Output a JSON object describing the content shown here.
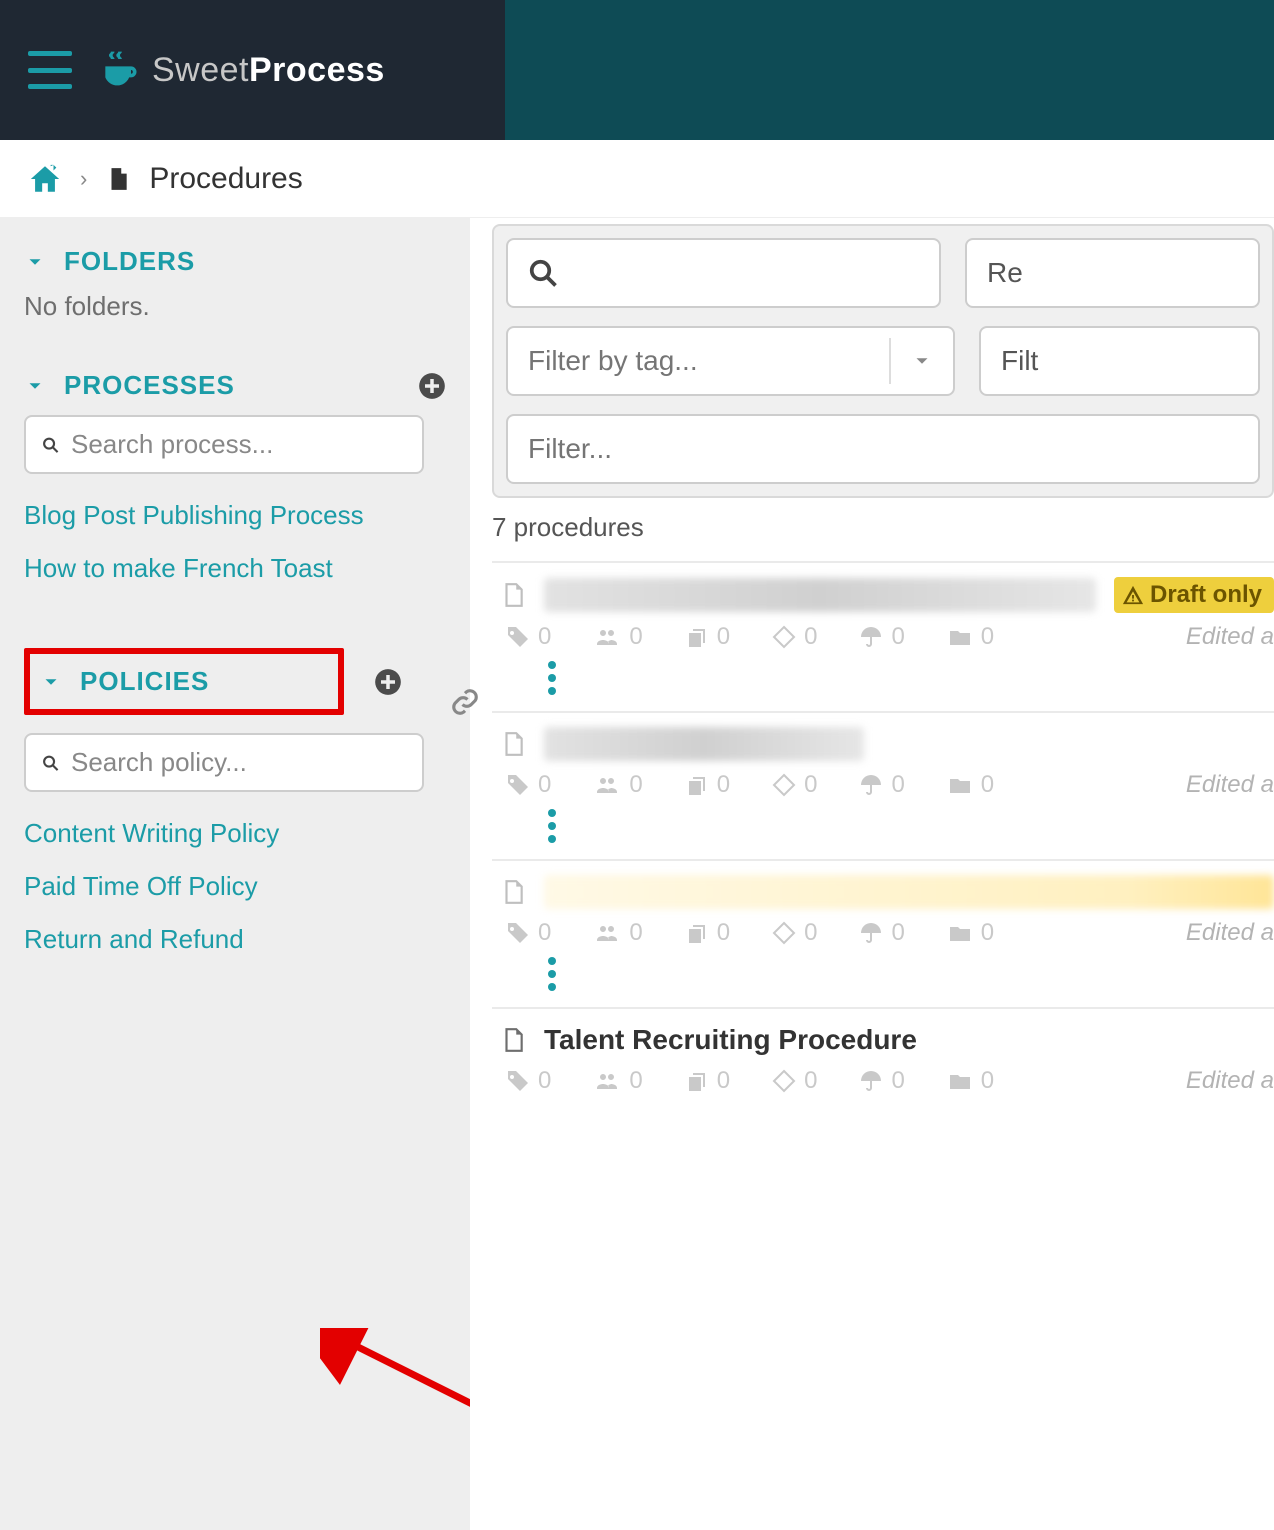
{
  "brand": {
    "light": "Sweet",
    "bold": "Process"
  },
  "breadcrumb": {
    "title": "Procedures"
  },
  "sidebar": {
    "folders": {
      "label": "FOLDERS",
      "empty": "No folders."
    },
    "processes": {
      "label": "PROCESSES",
      "search_placeholder": "Search process...",
      "items": [
        "Blog Post Publishing Process",
        "How to make French Toast"
      ]
    },
    "policies": {
      "label": "POLICIES",
      "search_placeholder": "Search policy...",
      "items": [
        "Content Writing Policy",
        "Paid Time Off Policy",
        "Return and Refund"
      ]
    }
  },
  "filters": {
    "search_placeholder": "",
    "tag_placeholder": "Filter by tag...",
    "generic_placeholder": "Filter...",
    "right1": "Re",
    "right2": "Filt"
  },
  "count": "7 procedures",
  "badge_draft": "Draft only",
  "meta_zero": "0",
  "edited_label": "Edited a",
  "rows": [
    {
      "title_visible": false,
      "draft": true
    },
    {
      "title_visible": false,
      "draft": false
    },
    {
      "title_visible": false,
      "draft": false,
      "yellow": true
    },
    {
      "title_visible": true,
      "title": "Talent Recruiting Procedure",
      "draft": false
    }
  ]
}
